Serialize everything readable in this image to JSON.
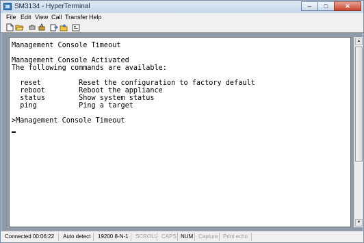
{
  "window": {
    "title": "SM3134 - HyperTerminal",
    "caption_buttons": {
      "minimize": "–",
      "maximize": "□",
      "close": "✕"
    }
  },
  "menu": [
    "File",
    "Edit",
    "View",
    "Call",
    "Transfer",
    "Help"
  ],
  "toolbar_icons": [
    "new-icon",
    "open-icon",
    "disconnect-icon",
    "dial-icon",
    "send-icon",
    "receive-icon",
    "properties-icon"
  ],
  "terminal": {
    "lines": [
      "Management Console Timeout",
      "",
      "Management Console Activated",
      "The following commands are available:",
      "",
      "  reset         Reset the configuration to factory default",
      "  reboot        Reboot the appliance",
      "  status        Show system status",
      "  ping          Ping a target",
      "",
      ">Management Console Timeout"
    ]
  },
  "status": {
    "connected": "Connected 00:06:22",
    "detect": "Auto detect",
    "settings": "19200 8-N-1",
    "scroll": "SCROLL",
    "caps": "CAPS",
    "num": "NUM",
    "capture": "Capture",
    "print_echo": "Print echo"
  }
}
